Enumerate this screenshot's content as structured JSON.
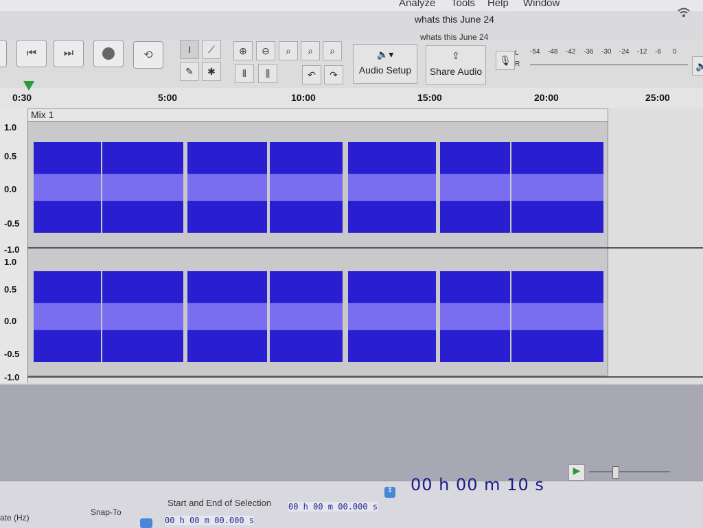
{
  "menu": {
    "items": [
      "Analyze",
      "Tools",
      "Help",
      "Window"
    ]
  },
  "window": {
    "title": "whats this June 24",
    "subtitle": "whats this June 24"
  },
  "toolbar": {
    "audio_setup_label": "Audio Setup",
    "share_audio_label": "Share Audio",
    "meter_channels": [
      "L",
      "R"
    ],
    "meter_scale": [
      "-54",
      "-48",
      "-42",
      "-36",
      "-30",
      "-24",
      "-12",
      "-6",
      "0"
    ]
  },
  "timeline": {
    "start_label": "0:30",
    "ticks": [
      "5:00",
      "10:00",
      "15:00",
      "20:00",
      "25:00"
    ]
  },
  "track": {
    "name": "Mix 1",
    "scale_top": [
      "1.0",
      "0.5",
      "0.0",
      "-0.5",
      "-1.0"
    ],
    "scale_bottom": [
      "1.0",
      "0.5",
      "0.0",
      "-0.5",
      "-1.0"
    ]
  },
  "selection": {
    "rate_label": "ate (Hz)",
    "snap_label": "Snap-To",
    "mode_label": "Start and End of Selection",
    "start_value": "00 h 00 m 00.000 s",
    "end_value": "00 h 00 m 00.000 s",
    "position": "00 h 00 m 10 s"
  },
  "colors": {
    "waveform": "#2a1fd0",
    "waveform_rms": "#7a6ef0",
    "playhead": "#2d9a3a"
  }
}
